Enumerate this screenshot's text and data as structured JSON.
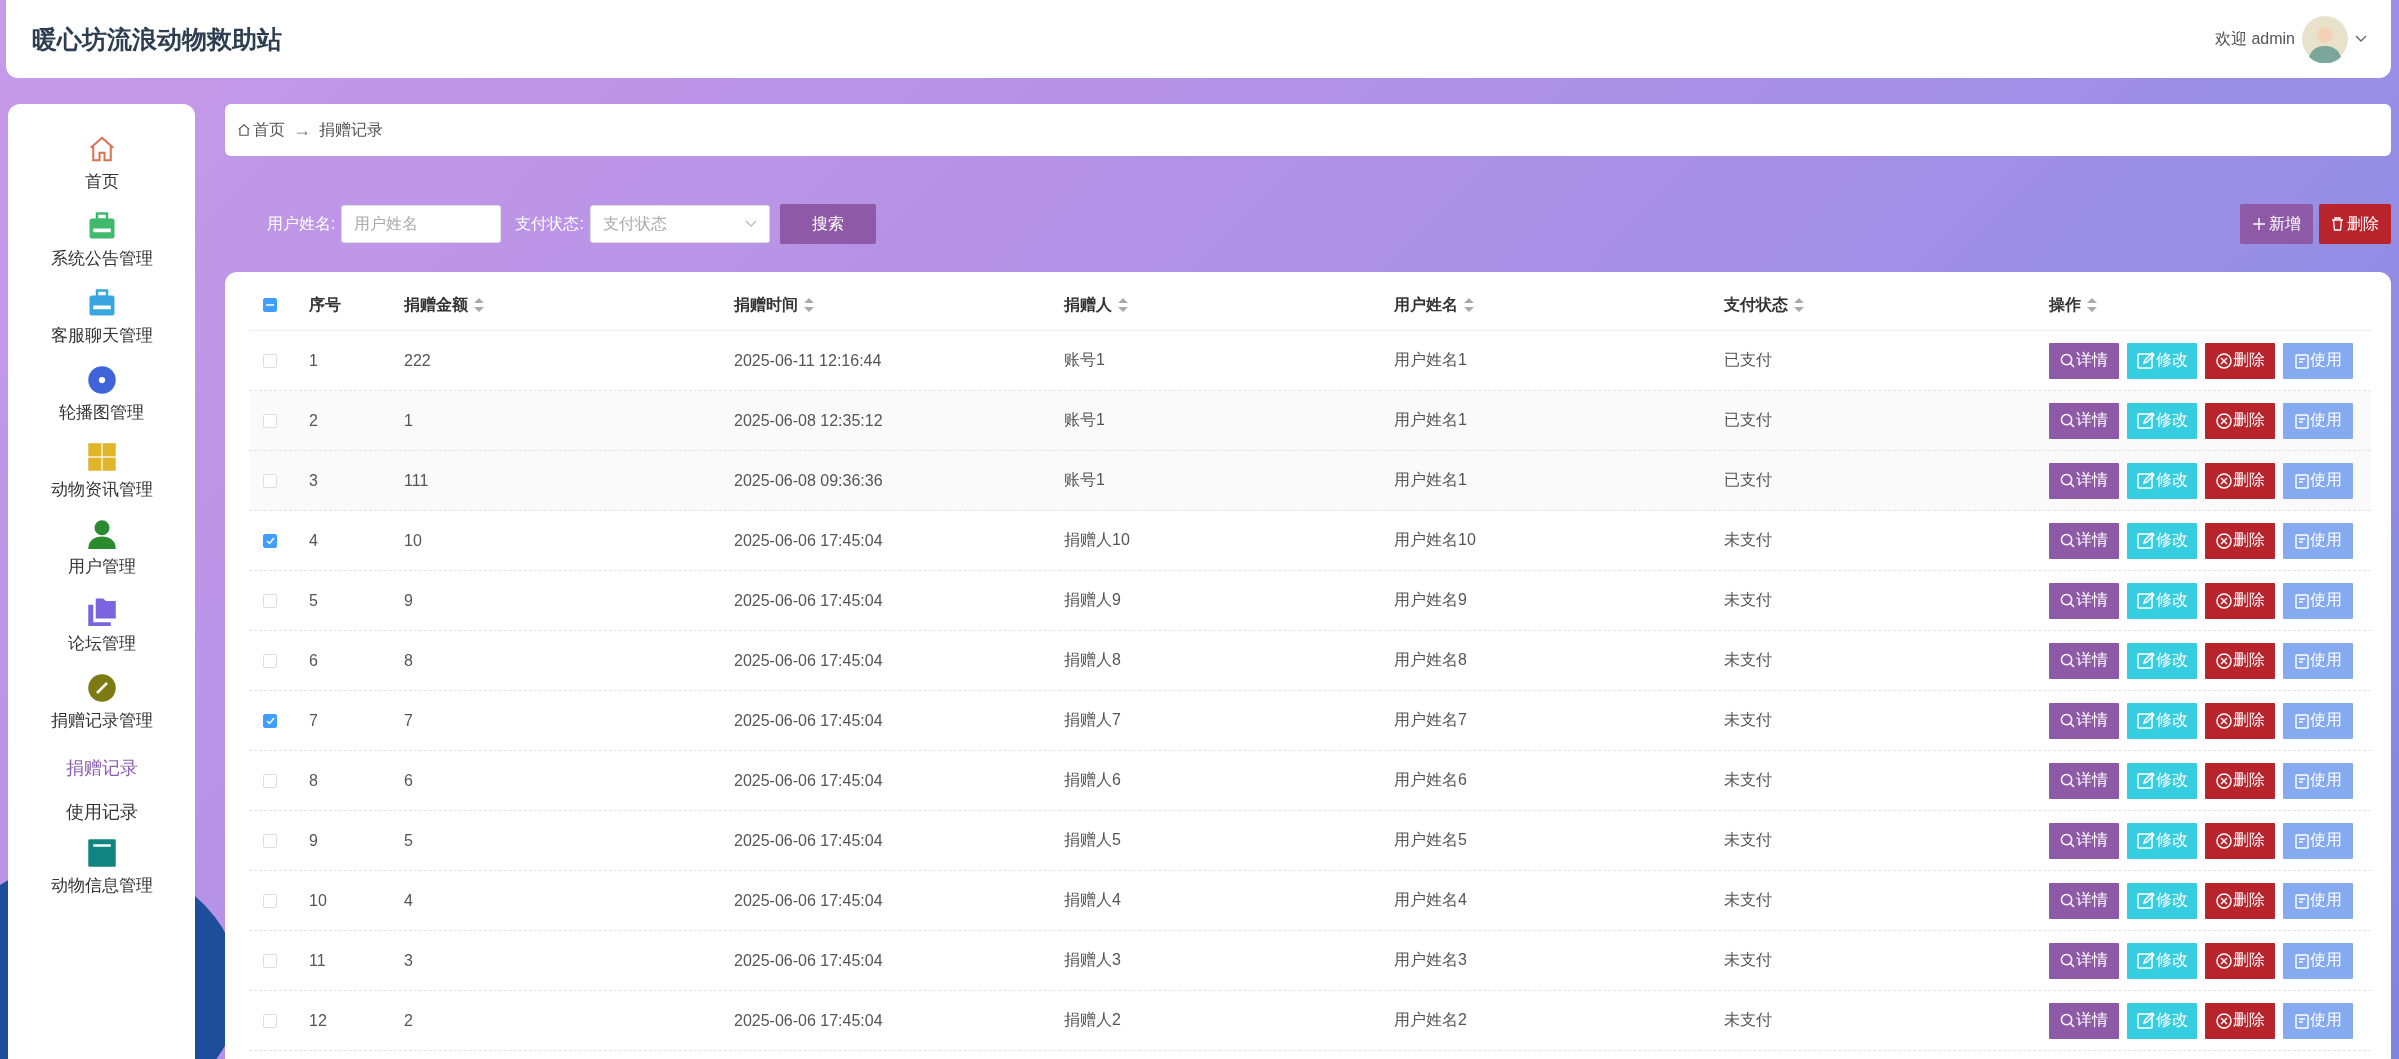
{
  "header": {
    "title": "暖心坊流浪动物救助站",
    "welcome": "欢迎 admin"
  },
  "sidebar": {
    "items": [
      {
        "label": "首页",
        "color": "#d9704f"
      },
      {
        "label": "系统公告管理",
        "color": "#3fb96b"
      },
      {
        "label": "客服聊天管理",
        "color": "#3aa6e0"
      },
      {
        "label": "轮播图管理",
        "color": "#3f63d9"
      },
      {
        "label": "动物资讯管理",
        "color": "#e0b52a"
      },
      {
        "label": "用户管理",
        "color": "#2a8a2e"
      },
      {
        "label": "论坛管理",
        "color": "#7b64e0"
      },
      {
        "label": "捐赠记录管理",
        "color": "#7d7a12",
        "children": [
          {
            "label": "捐赠记录",
            "selected": true
          },
          {
            "label": "使用记录",
            "selected": false
          }
        ]
      },
      {
        "label": "动物信息管理",
        "color": "#128580"
      }
    ]
  },
  "breadcrumb": {
    "home": "首页",
    "separator": "→",
    "current": "捐赠记录"
  },
  "search": {
    "fields": [
      {
        "label": "用户姓名:",
        "placeholder": "用户姓名",
        "kind": "text"
      },
      {
        "label": "支付状态:",
        "placeholder": "支付状态",
        "kind": "select"
      }
    ],
    "button": "搜索",
    "add_button": "新增",
    "delete_button": "删除"
  },
  "table": {
    "select_all": {
      "indeterminate": true
    },
    "columns": [
      "序号",
      "捐赠金额",
      "捐赠时间",
      "捐赠人",
      "用户姓名",
      "支付状态",
      "操作"
    ],
    "rows": [
      {
        "checked": false,
        "cells": [
          "1",
          "222",
          "2025-06-11 12:16:44",
          "账号1",
          "用户姓名1",
          "已支付"
        ],
        "actions": [
          "详情",
          "修改",
          "删除",
          "使用"
        ]
      },
      {
        "checked": false,
        "cells": [
          "2",
          "1",
          "2025-06-08 12:35:12",
          "账号1",
          "用户姓名1",
          "已支付"
        ],
        "actions": [
          "详情",
          "修改",
          "删除",
          "使用"
        ]
      },
      {
        "checked": false,
        "cells": [
          "3",
          "111",
          "2025-06-08 09:36:36",
          "账号1",
          "用户姓名1",
          "已支付"
        ],
        "actions": [
          "详情",
          "修改",
          "删除",
          "使用"
        ]
      },
      {
        "checked": true,
        "cells": [
          "4",
          "10",
          "2025-06-06 17:45:04",
          "捐赠人10",
          "用户姓名10",
          "未支付"
        ],
        "actions": [
          "详情",
          "修改",
          "删除",
          "使用"
        ]
      },
      {
        "checked": false,
        "cells": [
          "5",
          "9",
          "2025-06-06 17:45:04",
          "捐赠人9",
          "用户姓名9",
          "未支付"
        ],
        "actions": [
          "详情",
          "修改",
          "删除",
          "使用"
        ]
      },
      {
        "checked": false,
        "cells": [
          "6",
          "8",
          "2025-06-06 17:45:04",
          "捐赠人8",
          "用户姓名8",
          "未支付"
        ],
        "actions": [
          "详情",
          "修改",
          "删除",
          "使用"
        ]
      },
      {
        "checked": true,
        "cells": [
          "7",
          "7",
          "2025-06-06 17:45:04",
          "捐赠人7",
          "用户姓名7",
          "未支付"
        ],
        "actions": [
          "详情",
          "修改",
          "删除",
          "使用"
        ]
      },
      {
        "checked": false,
        "cells": [
          "8",
          "6",
          "2025-06-06 17:45:04",
          "捐赠人6",
          "用户姓名6",
          "未支付"
        ],
        "actions": [
          "详情",
          "修改",
          "删除",
          "使用"
        ]
      },
      {
        "checked": false,
        "cells": [
          "9",
          "5",
          "2025-06-06 17:45:04",
          "捐赠人5",
          "用户姓名5",
          "未支付"
        ],
        "actions": [
          "详情",
          "修改",
          "删除",
          "使用"
        ]
      },
      {
        "checked": false,
        "cells": [
          "10",
          "4",
          "2025-06-06 17:45:04",
          "捐赠人4",
          "用户姓名4",
          "未支付"
        ],
        "actions": [
          "详情",
          "修改",
          "删除",
          "使用"
        ]
      },
      {
        "checked": false,
        "cells": [
          "11",
          "3",
          "2025-06-06 17:45:04",
          "捐赠人3",
          "用户姓名3",
          "未支付"
        ],
        "actions": [
          "详情",
          "修改",
          "删除",
          "使用"
        ]
      },
      {
        "checked": false,
        "cells": [
          "12",
          "2",
          "2025-06-06 17:45:04",
          "捐赠人2",
          "用户姓名2",
          "未支付"
        ],
        "actions": [
          "详情",
          "修改",
          "删除",
          "使用"
        ]
      }
    ]
  }
}
